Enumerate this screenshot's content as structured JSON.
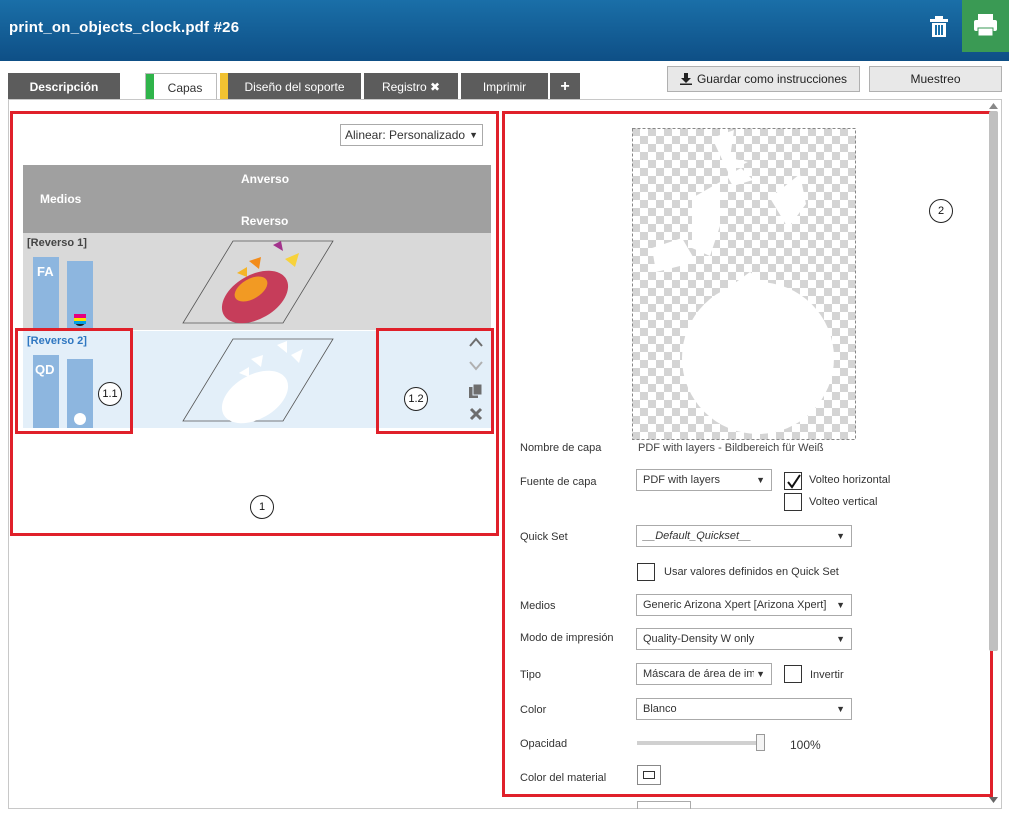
{
  "window": {
    "title": "print_on_objects_clock.pdf #26"
  },
  "tabs": [
    {
      "label": "Descripción"
    },
    {
      "label": "Capas"
    },
    {
      "label": "Diseño del soporte"
    },
    {
      "label": "Registro ✖"
    },
    {
      "label": "Imprimir"
    },
    {
      "label": "+"
    }
  ],
  "toolbar": {
    "save_instructions": "Guardar como instrucciones",
    "sampling": "Muestreo"
  },
  "left": {
    "align_select": "Alinear: Personalizado",
    "header": {
      "media": "Medios",
      "front": "Anverso",
      "back": "Reverso"
    },
    "layers": [
      {
        "name": "[Reverso 1]",
        "tag": "FA"
      },
      {
        "name": "[Reverso 2]",
        "tag": "QD"
      }
    ]
  },
  "callouts": {
    "c1": "1",
    "c11": "1.1",
    "c12": "1.2",
    "c2": "2"
  },
  "form": {
    "layer_name_label": "Nombre de capa",
    "layer_name_value": "PDF with layers - Bildbereich für Weiß",
    "source_label": "Fuente de capa",
    "source_value": "PDF with layers",
    "flip_h": "Volteo horizontal",
    "flip_v": "Volteo vertical",
    "quickset_label": "Quick Set",
    "quickset_value": "__Default_Quickset__",
    "use_quickset": "Usar valores definidos en Quick Set",
    "media_label": "Medios",
    "media_value": "Generic Arizona Xpert [Arizona Xpert]",
    "mode_label": "Modo de impresión",
    "mode_value": "Quality-Density W only",
    "type_label": "Tipo",
    "type_value": "Máscara de área de ima",
    "invert": "Invertir",
    "color_label": "Color",
    "color_value": "Blanco",
    "opacity_label": "Opacidad",
    "opacity_value": "100%",
    "opacity_fraction": 1.0,
    "material_color_label": "Color del material"
  },
  "colors": {
    "accent": "#0e4f86",
    "print_green": "#3a9a54",
    "highlight": "#e0202a",
    "selected_row": "#e3eff9"
  }
}
